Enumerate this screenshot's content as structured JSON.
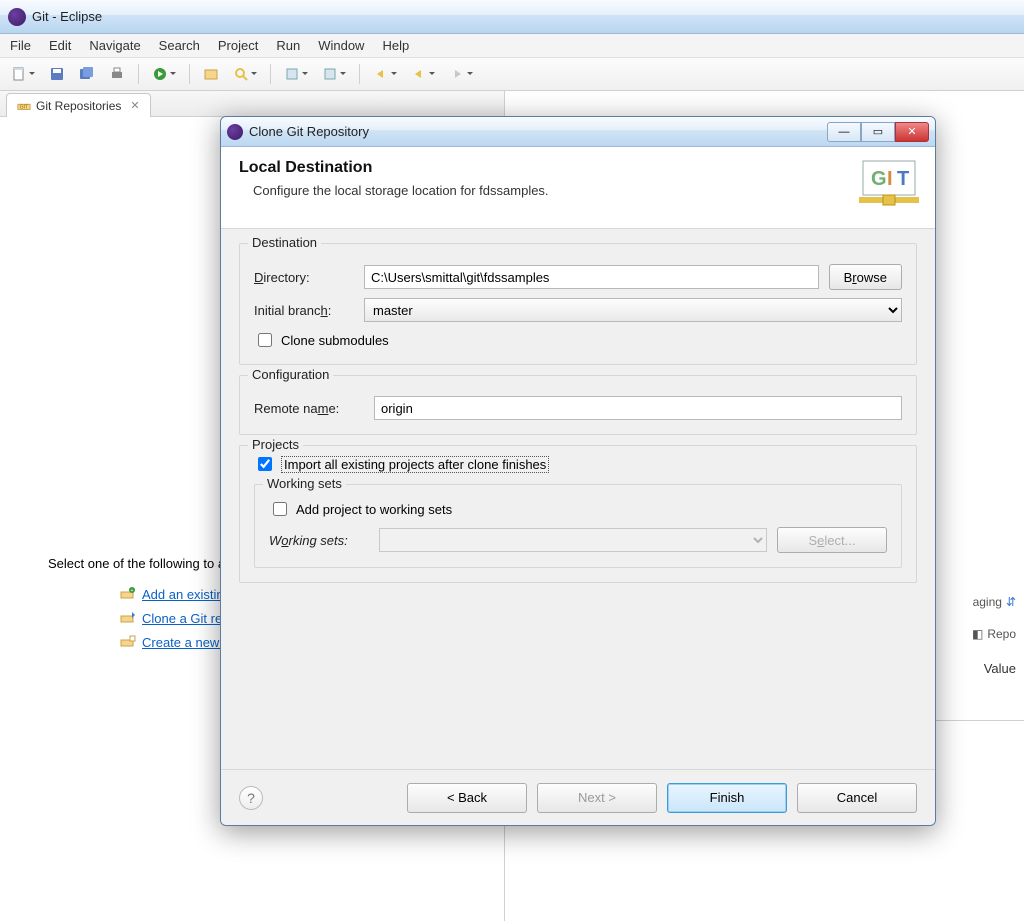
{
  "window": {
    "title": "Git - Eclipse"
  },
  "menu": {
    "items": [
      "File",
      "Edit",
      "Navigate",
      "Search",
      "Project",
      "Run",
      "Window",
      "Help"
    ]
  },
  "view": {
    "tab_label": "Git Repositories",
    "hint": "Select one of the following to add a repository to this view:",
    "links": {
      "add": "Add an existing local Git repository",
      "clone": "Clone a Git repository",
      "create": "Create a new local Git repository"
    }
  },
  "right": {
    "staging": "aging",
    "repo": "Repo",
    "value_header": "Value"
  },
  "dialog": {
    "title": "Clone Git Repository",
    "heading": "Local Destination",
    "subheading": "Configure the local storage location for fdssamples.",
    "dest_group": "Destination",
    "directory_label": "Directory:",
    "directory_value": "C:\\Users\\smittal\\git\\fdssamples",
    "browse": "Browse",
    "initial_branch_label": "Initial branch:",
    "initial_branch_value": "master",
    "clone_submodules": "Clone submodules",
    "config_group": "Configuration",
    "remote_name_label": "Remote name:",
    "remote_name_value": "origin",
    "projects_group": "Projects",
    "import_all": "Import all existing projects after clone finishes",
    "working_sets_group": "Working sets",
    "add_to_ws": "Add project to working sets",
    "working_sets_label": "Working sets:",
    "select_btn": "Select...",
    "back": "< Back",
    "next": "Next >",
    "finish": "Finish",
    "cancel": "Cancel"
  }
}
